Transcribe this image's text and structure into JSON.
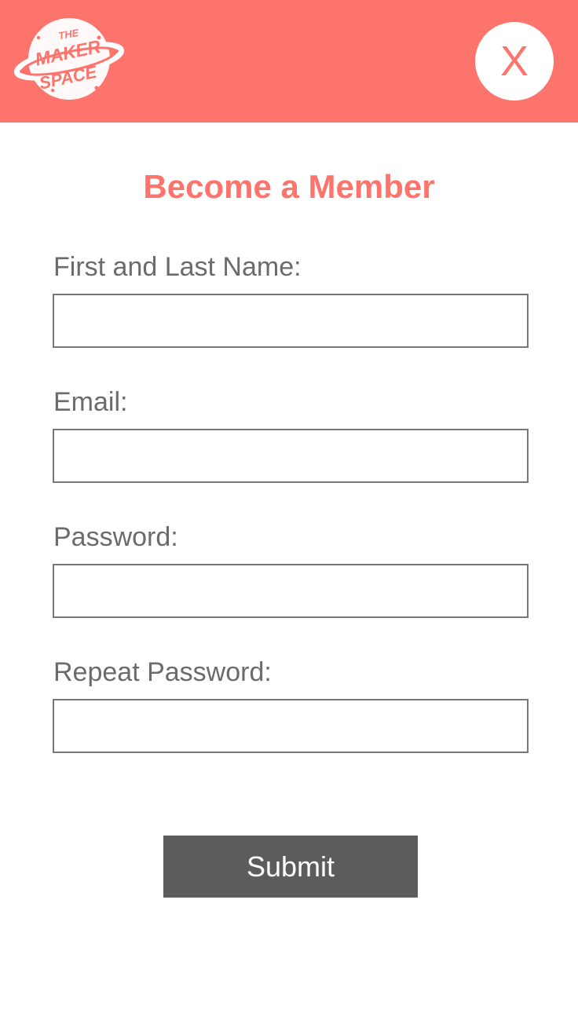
{
  "header": {
    "logo_text": [
      "THE",
      "MAKER",
      "SPACE"
    ],
    "close_label": "X"
  },
  "form": {
    "title": "Become a Member",
    "fields": [
      {
        "label": "First and Last Name:",
        "value": "",
        "placeholder": ""
      },
      {
        "label": "Email:",
        "value": "",
        "placeholder": ""
      },
      {
        "label": "Password:",
        "value": "",
        "placeholder": ""
      },
      {
        "label": "Repeat Password:",
        "value": "",
        "placeholder": ""
      }
    ],
    "submit_label": "Submit"
  },
  "colors": {
    "accent": "#fd746c",
    "button": "#5c5c5c",
    "label": "#6b6b6b",
    "border": "#777777"
  }
}
